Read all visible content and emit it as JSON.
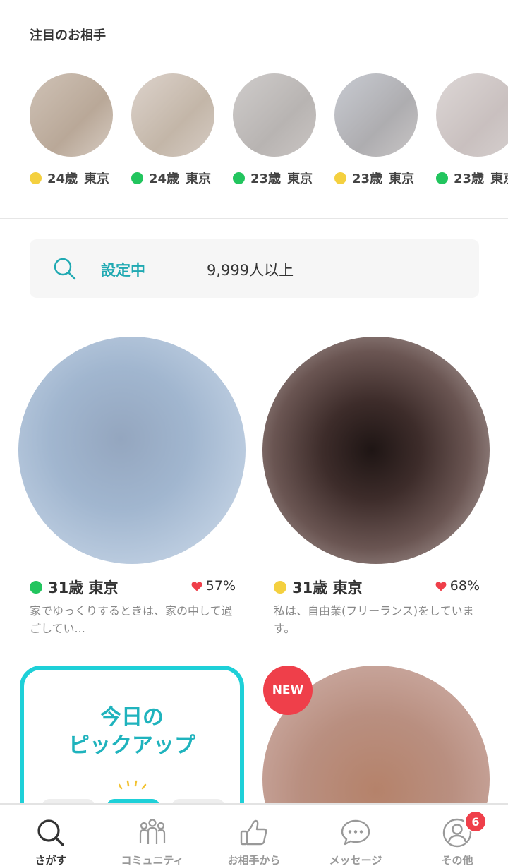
{
  "featured": {
    "title": "注目のお相手",
    "items": [
      {
        "age": "24歳",
        "location": "東京",
        "status_color": "#f4d03f",
        "photo": "linear-gradient(135deg,#cfc2b6,#b9a898 60%,#d7ccc2)"
      },
      {
        "age": "24歳",
        "location": "東京",
        "status_color": "#22c55e",
        "photo": "linear-gradient(135deg,#ddd3cc,#c3b6a8 60%,#d6ccc4)"
      },
      {
        "age": "23歳",
        "location": "東京",
        "status_color": "#22c55e",
        "photo": "linear-gradient(135deg,#cfcccb,#b8b4b2 60%,#cac5c3)"
      },
      {
        "age": "23歳",
        "location": "東京",
        "status_color": "#f4d03f",
        "photo": "linear-gradient(135deg,#c8cbd2,#aeadb0 60%,#c9c6c6)"
      },
      {
        "age": "23歳",
        "location": "東京",
        "status_color": "#22c55e",
        "photo": "linear-gradient(135deg,#ddd7d6,#c9c0bf 60%,#d6d0cf)"
      }
    ]
  },
  "search": {
    "status_label": "設定中",
    "result_count": "9,999人以上",
    "icon": "search-icon"
  },
  "cards": [
    {
      "age": "31歳",
      "location": "東京",
      "status_color": "#22c55e",
      "match": "57%",
      "description": "家でゆっくりするときは、家の中して過ごしてい...",
      "photo": "radial-gradient(circle at 45% 45%, #94a6bf 0%, #a1b6cf 40%, #b9cade 70%, #d5dde8 100%)"
    },
    {
      "age": "31歳",
      "location": "東京",
      "status_color": "#f4d03f",
      "match": "68%",
      "description": "私は、自由業(フリーランス)をしています。",
      "photo": "radial-gradient(circle at 48% 50%, #1e1514 0%, #3d2c2a 30%, #6a5552 60%, #a49592 85%, #c4b8b6 100%)"
    }
  ],
  "pickup": {
    "title_line1": "今日の",
    "title_line2": "ピックアップ"
  },
  "new_badge": "NEW",
  "colors": {
    "accent": "#1fa9b2",
    "heart": "#ef3f4a",
    "online": "#22c55e",
    "recent": "#f4d03f"
  },
  "nav": [
    {
      "label": "さがす",
      "icon": "search-icon",
      "active": true
    },
    {
      "label": "コミュニティ",
      "icon": "community-icon",
      "active": false
    },
    {
      "label": "お相手から",
      "icon": "thumbs-up-icon",
      "active": false
    },
    {
      "label": "メッセージ",
      "icon": "chat-bubble-icon",
      "active": false
    },
    {
      "label": "その他",
      "icon": "profile-icon",
      "active": false,
      "badge": "6"
    }
  ]
}
